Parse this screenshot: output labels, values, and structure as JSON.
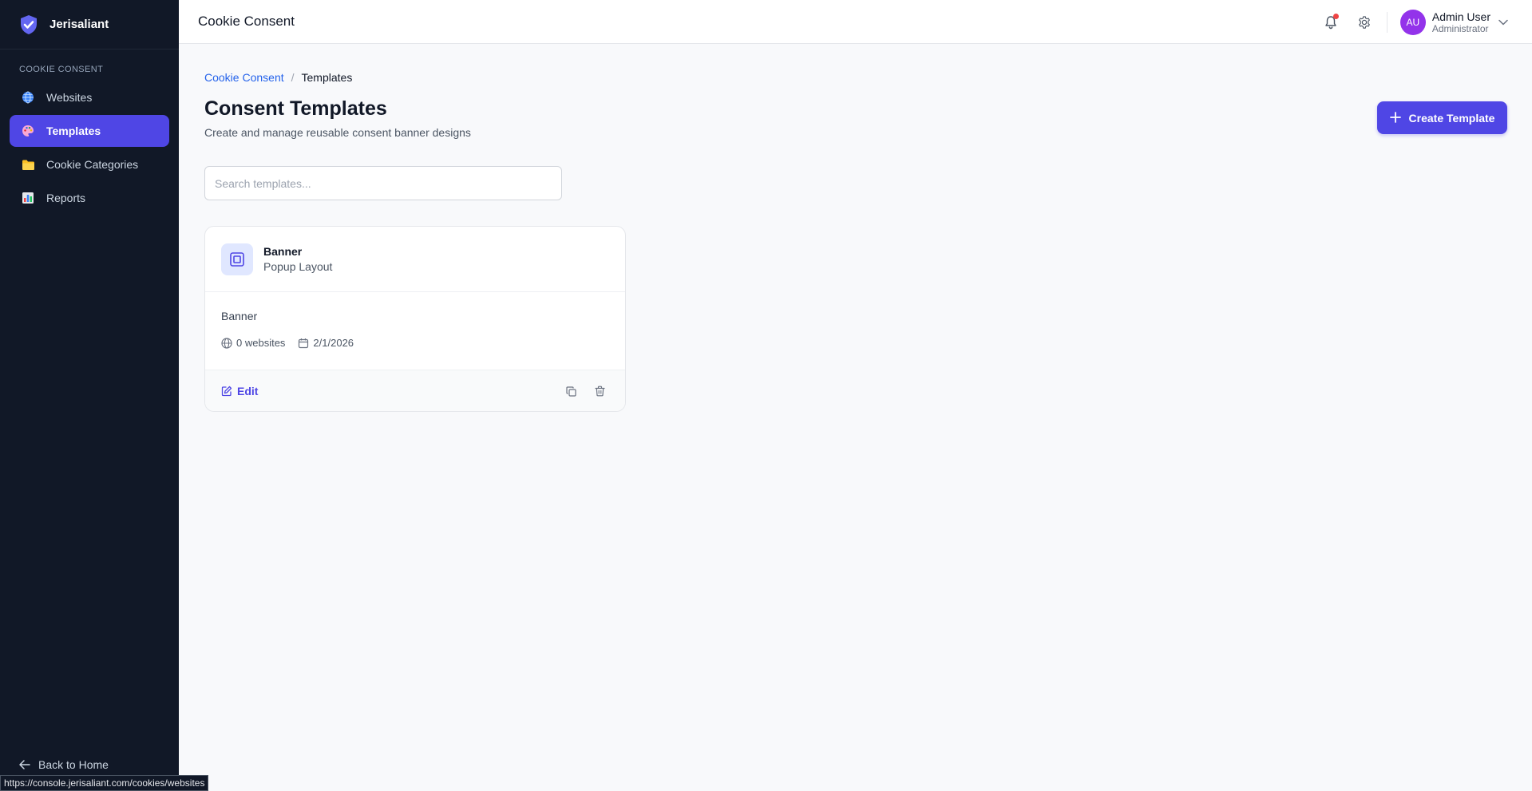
{
  "brand": {
    "name": "Jerisaliant"
  },
  "sidebar": {
    "section_label": "COOKIE CONSENT",
    "items": [
      {
        "label": "Websites",
        "icon": "globe-icon",
        "active": false
      },
      {
        "label": "Templates",
        "icon": "palette-icon",
        "active": true
      },
      {
        "label": "Cookie Categories",
        "icon": "folder-icon",
        "active": false
      },
      {
        "label": "Reports",
        "icon": "bar-chart-icon",
        "active": false
      }
    ],
    "back_label": "Back to Home"
  },
  "topbar": {
    "title": "Cookie Consent",
    "user": {
      "initials": "AU",
      "name": "Admin User",
      "role": "Administrator"
    }
  },
  "breadcrumb": {
    "parent": "Cookie Consent",
    "separator": "/",
    "current": "Templates"
  },
  "page": {
    "title": "Consent Templates",
    "subtitle": "Create and manage reusable consent banner designs",
    "create_label": "Create Template"
  },
  "search": {
    "placeholder": "Search templates...",
    "value": ""
  },
  "templates": [
    {
      "name": "Banner",
      "layout": "Popup Layout",
      "description": "Banner",
      "websites": "0 websites",
      "date": "2/1/2026",
      "edit_label": "Edit"
    }
  ],
  "status_url": "https://console.jerisaliant.com/cookies/websites",
  "colors": {
    "sidebar_bg": "#111827",
    "accent": "#4f46e5",
    "avatar": "#9333ea",
    "notification": "#ef4444",
    "link": "#2563eb"
  }
}
